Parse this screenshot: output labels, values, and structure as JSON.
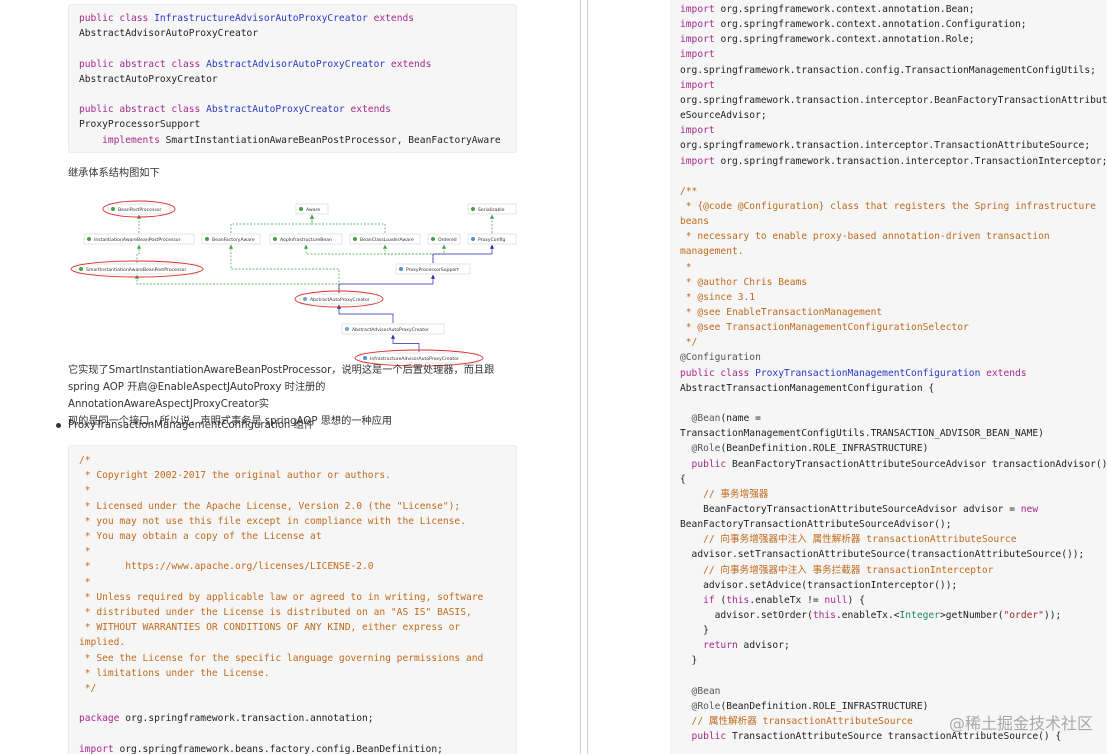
{
  "left_page": {
    "code_block_1": [
      [
        [
          "kw",
          "public class "
        ],
        [
          "cls",
          "InfrastructureAdvisorAutoProxyCreator"
        ],
        [
          "kw",
          " extends"
        ]
      ],
      [
        [
          "p",
          "AbstractAdvisorAutoProxyCreator"
        ]
      ],
      [],
      [
        [
          "kw",
          "public abstract class "
        ],
        [
          "cls",
          "AbstractAdvisorAutoProxyCreator"
        ],
        [
          "kw",
          " extends"
        ]
      ],
      [
        [
          "p",
          "AbstractAutoProxyCreator"
        ]
      ],
      [],
      [
        [
          "kw",
          "public abstract class "
        ],
        [
          "cls",
          "AbstractAutoProxyCreator"
        ],
        [
          "kw",
          " extends"
        ]
      ],
      [
        [
          "p",
          "ProxyProcessorSupport"
        ]
      ],
      [
        [
          "p",
          "    "
        ],
        [
          "kw",
          "implements"
        ],
        [
          "p",
          " SmartInstantiationAwareBeanPostProcessor, BeanFactoryAware"
        ]
      ]
    ],
    "diagram_intro": "继承体系结构图如下",
    "diagram": {
      "nodes": {
        "bean_post_processor": "BeanPostProcessor",
        "aware": "Aware",
        "serializable": "Serializable",
        "instantiation_aware": "InstantiationAwareBeanPostProcessor",
        "bean_factory_aware": "BeanFactoryAware",
        "aop_infrastructure_bean": "AopInfrastructureBean",
        "bean_class_loader_aware": "BeanClassLoaderAware",
        "ordered": "Ordered",
        "proxy_config": "ProxyConfig",
        "smart_instantiation_aware": "SmartInstantiationAwareBeanPostProcessor",
        "proxy_processor_support": "ProxyProcessorSupport",
        "abstract_auto_proxy_creator": "AbstractAutoProxyCreator",
        "abstract_advisor_auto_proxy_creator": "AbstractAdvisorAutoProxyCreator",
        "infrastructure_advisor_auto_proxy_creator": "InfrastructureAdvisorAutoProxyCreator"
      },
      "colors": {
        "implements_edge": "#3fa34d",
        "extends_edge": "#2a2aa8",
        "highlight": "#d9302c"
      }
    },
    "description": [
      "它实现了SmartInstantiationAwareBeanPostProcessor，说明这是一个后置处理器，而且跟",
      "spring AOP 开启@EnableAspectJAutoProxy 时注册的 AnnotationAwareAspectJProxyCreator实",
      "现的是同一个接口，所以说，声明式事务是 springAOP 思想的一种应用"
    ],
    "bullet_item": "ProxyTransactionManagementConfiguration 组件",
    "code_block_2": [
      [
        [
          "cmt",
          "/*"
        ]
      ],
      [
        [
          "cmt",
          " * Copyright 2002-2017 the original author or authors."
        ]
      ],
      [
        [
          "cmt",
          " *"
        ]
      ],
      [
        [
          "cmt",
          " * Licensed under the Apache License, Version 2.0 (the \"License\");"
        ]
      ],
      [
        [
          "cmt",
          " * you may not use this file except in compliance with the License."
        ]
      ],
      [
        [
          "cmt",
          " * You may obtain a copy of the License at"
        ]
      ],
      [
        [
          "cmt",
          " *"
        ]
      ],
      [
        [
          "cmt",
          " *      https://www.apache.org/licenses/LICENSE-2.0"
        ]
      ],
      [
        [
          "cmt",
          " *"
        ]
      ],
      [
        [
          "cmt",
          " * Unless required by applicable law or agreed to in writing, software"
        ]
      ],
      [
        [
          "cmt",
          " * distributed under the License is distributed on an \"AS IS\" BASIS,"
        ]
      ],
      [
        [
          "cmt",
          " * WITHOUT WARRANTIES OR CONDITIONS OF ANY KIND, either express or"
        ]
      ],
      [
        [
          "cmt",
          "implied."
        ]
      ],
      [
        [
          "cmt",
          " * See the License for the specific language governing permissions and"
        ]
      ],
      [
        [
          "cmt",
          " * limitations under the License."
        ]
      ],
      [
        [
          "cmt",
          " */"
        ]
      ],
      [],
      [
        [
          "kw",
          "package "
        ],
        [
          "p",
          "org.springframework.transaction.annotation;"
        ]
      ],
      [],
      [
        [
          "kw",
          "import "
        ],
        [
          "p",
          "org.springframework.beans.factory.config.BeanDefinition;"
        ]
      ]
    ]
  },
  "right_page": {
    "code_block": [
      [
        [
          "kw",
          "import "
        ],
        [
          "p",
          "org.springframework.context.annotation.Bean;"
        ]
      ],
      [
        [
          "kw",
          "import "
        ],
        [
          "p",
          "org.springframework.context.annotation.Configuration;"
        ]
      ],
      [
        [
          "kw",
          "import "
        ],
        [
          "p",
          "org.springframework.context.annotation.Role;"
        ]
      ],
      [
        [
          "kw",
          "import"
        ]
      ],
      [
        [
          "p",
          "org.springframework.transaction.config.TransactionManagementConfigUtils;"
        ]
      ],
      [
        [
          "kw",
          "import"
        ]
      ],
      [
        [
          "p",
          "org.springframework.transaction.interceptor.BeanFactoryTransactionAttribut"
        ]
      ],
      [
        [
          "p",
          "eSourceAdvisor;"
        ]
      ],
      [
        [
          "kw",
          "import"
        ]
      ],
      [
        [
          "p",
          "org.springframework.transaction.interceptor.TransactionAttributeSource;"
        ]
      ],
      [
        [
          "kw",
          "import "
        ],
        [
          "p",
          "org.springframework.transaction.interceptor.TransactionInterceptor;"
        ]
      ],
      [],
      [
        [
          "cmt",
          "/**"
        ]
      ],
      [
        [
          "cmt",
          " * {@code @Configuration} class that registers the Spring infrastructure"
        ]
      ],
      [
        [
          "cmt",
          "beans"
        ]
      ],
      [
        [
          "cmt",
          " * necessary to enable proxy-based annotation-driven transaction"
        ]
      ],
      [
        [
          "cmt",
          "management."
        ]
      ],
      [
        [
          "cmt",
          " *"
        ]
      ],
      [
        [
          "cmt",
          " * @author Chris Beams"
        ]
      ],
      [
        [
          "cmt",
          " * @since 3.1"
        ]
      ],
      [
        [
          "cmt",
          " * @see EnableTransactionManagement"
        ]
      ],
      [
        [
          "cmt",
          " * @see TransactionManagementConfigurationSelector"
        ]
      ],
      [
        [
          "cmt",
          " */"
        ]
      ],
      [
        [
          "ann",
          "@Configuration"
        ]
      ],
      [
        [
          "kw",
          "public class "
        ],
        [
          "cls",
          "ProxyTransactionManagementConfiguration"
        ],
        [
          "kw",
          " extends"
        ]
      ],
      [
        [
          "p",
          "AbstractTransactionManagementConfiguration {"
        ]
      ],
      [],
      [
        [
          "ann",
          "  @Bean"
        ],
        [
          "p",
          "(name = "
        ]
      ],
      [
        [
          "p",
          "TransactionManagementConfigUtils.TRANSACTION_ADVISOR_BEAN_NAME)"
        ]
      ],
      [
        [
          "ann",
          "  @Role"
        ],
        [
          "p",
          "(BeanDefinition.ROLE_INFRASTRUCTURE)"
        ]
      ],
      [
        [
          "kw",
          "  public "
        ],
        [
          "p",
          "BeanFactoryTransactionAttributeSourceAdvisor transactionAdvisor()"
        ]
      ],
      [
        [
          "p",
          "{"
        ]
      ],
      [
        [
          "cmt",
          "    // 事务增强器"
        ]
      ],
      [
        [
          "p",
          "    BeanFactoryTransactionAttributeSourceAdvisor advisor = "
        ],
        [
          "kw",
          "new"
        ]
      ],
      [
        [
          "p",
          "BeanFactoryTransactionAttributeSourceAdvisor();"
        ]
      ],
      [
        [
          "cmt",
          "    // 向事务增强器中注入 属性解析器 transactionAttributeSource"
        ]
      ],
      [
        [
          "p",
          "  advisor.setTransactionAttributeSource(transactionAttributeSource());"
        ]
      ],
      [
        [
          "cmt",
          "    // 向事务增强器中注入 事务拦截器 transactionInterceptor"
        ]
      ],
      [
        [
          "p",
          "    advisor.setAdvice(transactionInterceptor());"
        ]
      ],
      [
        [
          "kw",
          "    if "
        ],
        [
          "p",
          "("
        ],
        [
          "kw",
          "this"
        ],
        [
          "p",
          ".enableTx != "
        ],
        [
          "kw",
          "null"
        ],
        [
          "p",
          ") {"
        ]
      ],
      [
        [
          "p",
          "      advisor.setOrder("
        ],
        [
          "kw",
          "this"
        ],
        [
          "p",
          ".enableTx.<"
        ],
        [
          "gen",
          "Integer"
        ],
        [
          "p",
          ">getNumber("
        ],
        [
          "str",
          "\"order\""
        ],
        [
          "p",
          "));"
        ]
      ],
      [
        [
          "p",
          "    }"
        ]
      ],
      [
        [
          "kw",
          "    return "
        ],
        [
          "p",
          "advisor;"
        ]
      ],
      [
        [
          "p",
          "  }"
        ]
      ],
      [],
      [
        [
          "ann",
          "  @Bean"
        ]
      ],
      [
        [
          "ann",
          "  @Role"
        ],
        [
          "p",
          "(BeanDefinition.ROLE_INFRASTRUCTURE)"
        ]
      ],
      [
        [
          "cmt",
          "  // 属性解析器 transactionAttributeSource"
        ]
      ],
      [
        [
          "kw",
          "  public "
        ],
        [
          "p",
          "TransactionAttributeSource transactionAttributeSource() {"
        ]
      ]
    ]
  },
  "watermark": "@稀土掘金技术社区"
}
